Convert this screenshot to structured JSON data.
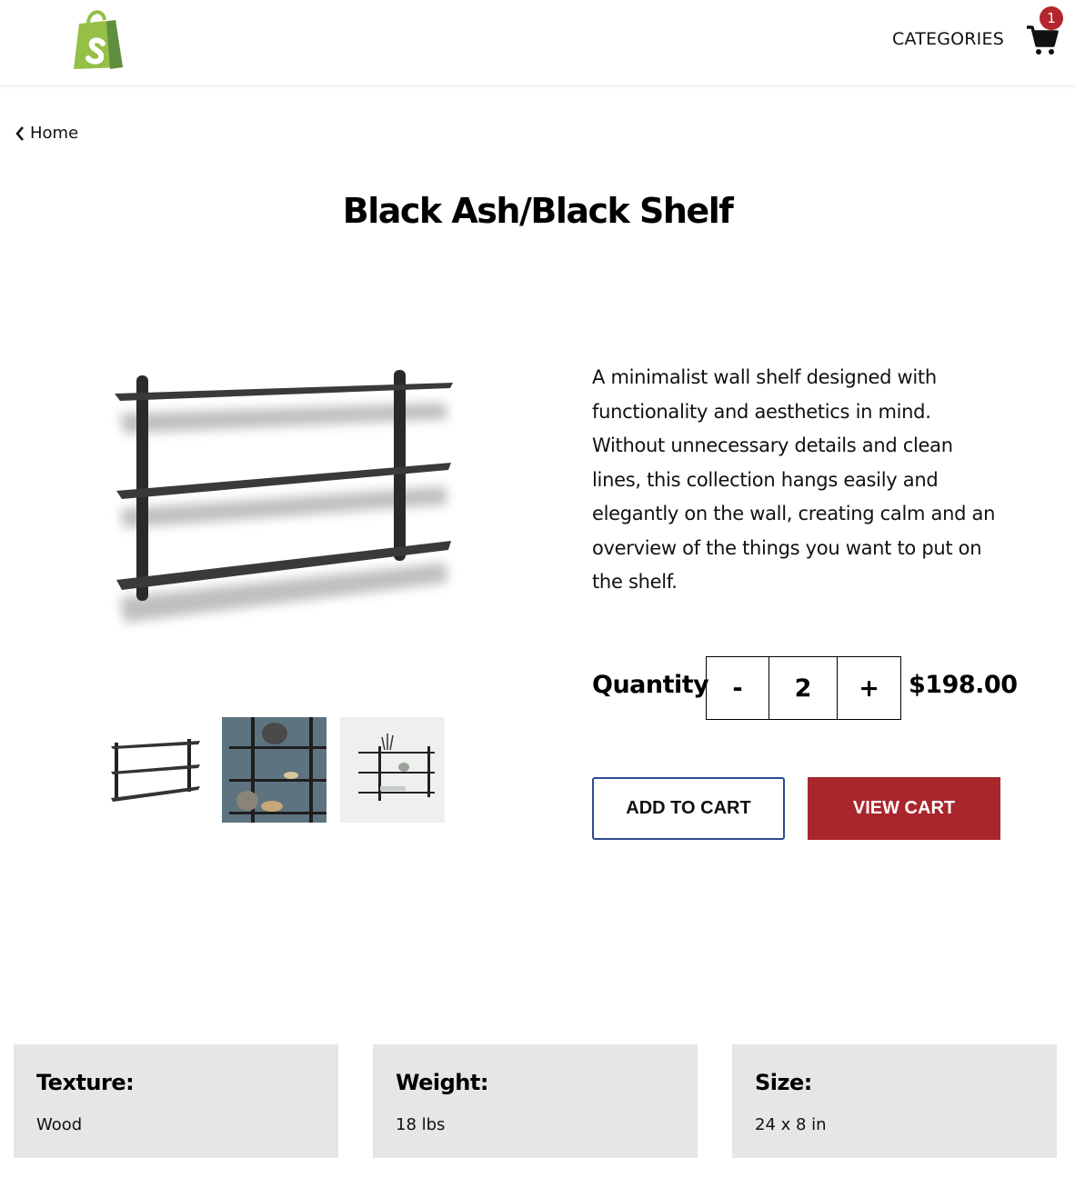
{
  "header": {
    "logo_icon": "shopify-bag-icon",
    "nav_categories": "CATEGORIES",
    "cart_icon": "cart-icon",
    "cart_count": "1",
    "badge_color": "#b3262d"
  },
  "breadcrumb": {
    "icon": "chevron-left-icon",
    "label": "Home"
  },
  "product": {
    "title": "Black Ash/Black Shelf",
    "description": "A minimalist wall shelf designed with functionality and aesthetics in mind. Without unnecessary details and clean lines, this collection hangs easily and elegantly on the wall, creating calm and an overview of the things you want to put on the shelf.",
    "quantity_label": "Quantity",
    "quantity_minus": "-",
    "quantity_value": "2",
    "quantity_plus": "+",
    "price": "$198.00"
  },
  "actions": {
    "add_to_cart": "ADD TO CART",
    "view_cart": "VIEW CART",
    "view_cart_color": "#a8262c",
    "add_to_cart_border": "#2e4a8f"
  },
  "specs": [
    {
      "label": "Texture:",
      "value": "Wood"
    },
    {
      "label": "Weight:",
      "value": "18 lbs"
    },
    {
      "label": "Size:",
      "value": "24 x 8 in"
    }
  ]
}
